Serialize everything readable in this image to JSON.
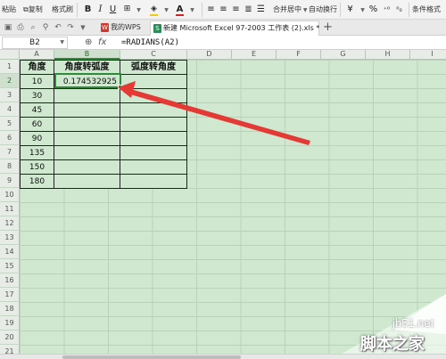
{
  "toolbar": {
    "paste_label": "粘贴",
    "copy_label": "复制",
    "format_painter_label": "格式刷",
    "bold_label": "B",
    "italic_label": "I",
    "underline_label": "U",
    "font_color_label": "A",
    "merge_center_label": "合并居中",
    "auto_wrap_label": "自动换行",
    "currency_label": "¥",
    "percent_label": "%",
    "conditional_format_label": "条件格式",
    "font_color": "#e02020",
    "fill_color": "#f5c518"
  },
  "tabs": {
    "my_wps_label": "我的WPS",
    "document_label": "新建 Microsoft Excel 97-2003 工作表 (2).xls *",
    "add_label": "+"
  },
  "formula_bar": {
    "cell_ref": "B2",
    "fx_label": "fx",
    "formula": "=RADIANS(A2)"
  },
  "grid": {
    "columns": [
      "A",
      "B",
      "C",
      "D",
      "E",
      "F",
      "G",
      "H",
      "I",
      "J"
    ],
    "rows": [
      "1",
      "2",
      "3",
      "4",
      "5",
      "6",
      "7",
      "8",
      "9",
      "10",
      "11",
      "12",
      "13",
      "14",
      "15",
      "16",
      "17",
      "18",
      "19",
      "20",
      "21"
    ],
    "selected_column": "B",
    "selected_row": "2"
  },
  "table": {
    "headers": [
      "角度",
      "角度转弧度",
      "弧度转角度"
    ],
    "rows": [
      [
        "10",
        "0.174532925",
        ""
      ],
      [
        "30",
        "",
        ""
      ],
      [
        "45",
        "",
        ""
      ],
      [
        "60",
        "",
        ""
      ],
      [
        "90",
        "",
        ""
      ],
      [
        "135",
        "",
        ""
      ],
      [
        "150",
        "",
        ""
      ],
      [
        "180",
        "",
        ""
      ]
    ]
  },
  "watermark": {
    "url": "jb51.net",
    "name": "脚本之家"
  },
  "colors": {
    "sheet_background": "#cfe8cf",
    "accent_green": "#2e8b3a",
    "arrow_red": "#e53935"
  }
}
